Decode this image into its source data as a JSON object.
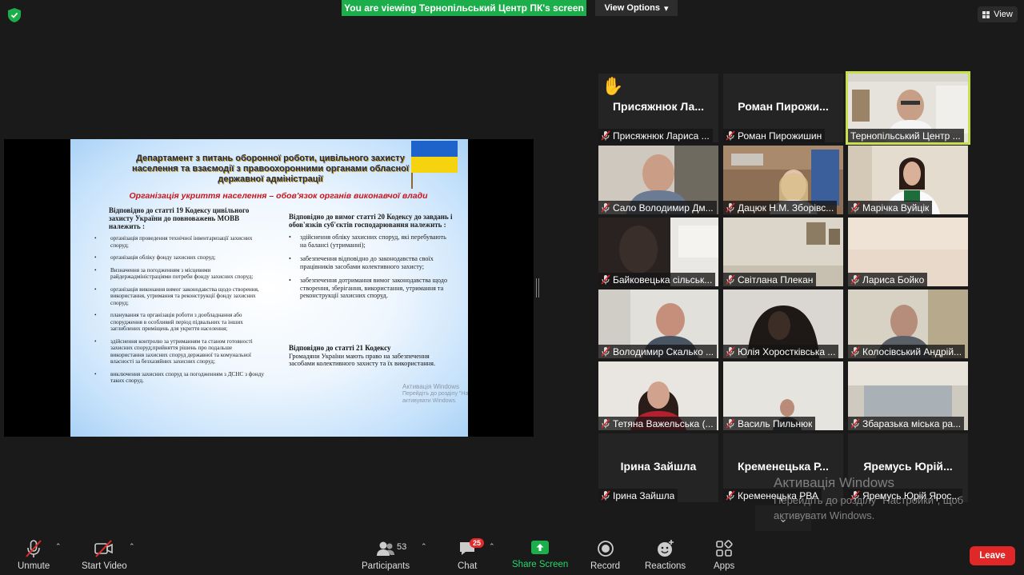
{
  "top": {
    "banner": "You are viewing Тернопільський Центр ПК's screen",
    "view_options": "View Options",
    "view_button": "View"
  },
  "slide": {
    "title": "Департамент з питань оборонної роботи, цивільного захисту населення та взаємодії з правоохоронними органами обласної державної адміністрації",
    "subtitle": "Організація укриття населення – обов'язок органів виконавчої влади",
    "left_head": "Відповідно до статті 19 Кодексу цивільного захисту України до повноважень МОВВ належить :",
    "left_items": [
      "організація проведення технічної інвентаризації захисних споруд;",
      "організація обліку фонду захисних споруд;",
      "Визначення за погодженням з місцевими райдержадміністраціями потреби фонду захисних споруд;",
      "організація виконання вимог законодавства щодо створення, використання, утримання та реконструкції фонду захисних споруд;",
      "планування та організація роботи з дообладнання або спорудження в особливий період підвальних та інших заглиблених приміщень для укриття населення;",
      "здійснення контролю за утриманням та станом готовності захисних споруд;прийняття рішень про подальше використання захисних споруд державної та комунальної власності за безхазяйних захисних споруд;",
      "виключення захисних споруд за погодженням з ДСНС з фонду таких споруд."
    ],
    "right_head": "Відповідно до вимог статті 20 Кодексу до завдань і обов'язків суб'єктів господарювання належить :",
    "right_items": [
      "здійснення обліку захисних споруд, які перебувають на балансі (утриманні);",
      "забезпечення відповідно до законодавства своїх працівників засобами колективного захисту;",
      "забезпечення дотримання вимог законодавства щодо створення, зберігання, використання, утримання та реконструкції захисних споруд."
    ],
    "art21_head": "Відповідно до статті 21 Кодексу",
    "art21_text": "Громадяни України мають право на забезпечення засобами колективного захисту та їх використання.",
    "activation_title": "Активація Windows",
    "activation_text": "Перейдіть до розділу \"Настройки\", щоб активувати Windows."
  },
  "participants": [
    {
      "big": "Присяжнюк Ла...",
      "name": "Присяжнюк Лариса ...",
      "hand": "✋"
    },
    {
      "big": "Роман Пирожи...",
      "name": "Роман Пирожишин"
    },
    {
      "name": "Тернопільський Центр ..."
    },
    {
      "name": "Сало Володимир Дм..."
    },
    {
      "name": "Дацюк Н.М. Зборівс..."
    },
    {
      "name": "Марічка Вуйцік"
    },
    {
      "name": "Байковецька сільськ..."
    },
    {
      "name": "Світлана Плекан"
    },
    {
      "name": "Лариса Бойко"
    },
    {
      "name": "Володимир Скалько ..."
    },
    {
      "name": "Юлія Хоростківська ..."
    },
    {
      "name": "Колосівський Андрій..."
    },
    {
      "name": "Тетяна Важельська (..."
    },
    {
      "name": "Василь Пильнюк"
    },
    {
      "name": "Збаразька міська ра..."
    },
    {
      "big": "Ірина Зайшла",
      "name": "Ірина Зайшла"
    },
    {
      "big": "Кременецька Р...",
      "name": "Кременецька РВА"
    },
    {
      "big": "Яремусь Юрій...",
      "name": "Яремусь Юрій Ярос..."
    }
  ],
  "windows_activation": {
    "title": "Активація Windows",
    "line": "Перейдіть до розділу \"Настройки\", щоб активувати Windows."
  },
  "toolbar": {
    "unmute": "Unmute",
    "start_video": "Start Video",
    "participants": "Participants",
    "participants_count": "53",
    "chat": "Chat",
    "chat_badge": "25",
    "share_screen": "Share Screen",
    "record": "Record",
    "reactions": "Reactions",
    "apps": "Apps",
    "leave": "Leave"
  },
  "colors": {
    "share_green": "#1cae4b",
    "active_border": "#c7e04b",
    "leave_red": "#e02828"
  }
}
